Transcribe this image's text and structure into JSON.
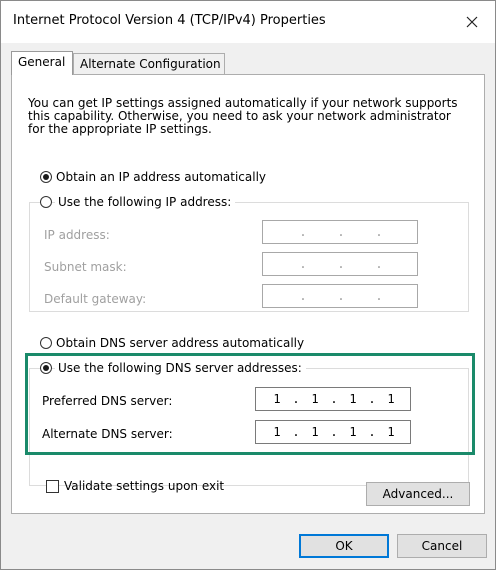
{
  "window": {
    "title": "Internet Protocol Version 4 (TCP/IPv4) Properties"
  },
  "tabs": [
    {
      "label": "General",
      "active": true
    },
    {
      "label": "Alternate Configuration",
      "active": false
    }
  ],
  "description": "You can get IP settings assigned automatically if your network supports this capability. Otherwise, you need to ask your network administrator for the appropriate IP settings.",
  "ip_section": {
    "auto_label": "Obtain an IP address automatically",
    "manual_label": "Use the following IP address:",
    "selected": "auto",
    "fields": [
      {
        "label": "IP address:",
        "value": [
          "",
          "",
          "",
          ""
        ]
      },
      {
        "label": "Subnet mask:",
        "value": [
          "",
          "",
          "",
          ""
        ]
      },
      {
        "label": "Default gateway:",
        "value": [
          "",
          "",
          "",
          ""
        ]
      }
    ]
  },
  "dns_section": {
    "auto_label": "Obtain DNS server address automatically",
    "manual_label": "Use the following DNS server addresses:",
    "selected": "manual",
    "preferred_label": "Preferred DNS server:",
    "preferred": [
      "1",
      "1",
      "1",
      "1"
    ],
    "alternate_label": "Alternate DNS server:",
    "alternate": [
      "1",
      "1",
      "1",
      "1"
    ]
  },
  "validate": {
    "label": "Validate settings upon exit",
    "checked": false
  },
  "buttons": {
    "advanced": "Advanced...",
    "ok": "OK",
    "cancel": "Cancel"
  },
  "colors": {
    "highlight": "#1a8a6a",
    "default_button_border": "#0078d7"
  }
}
